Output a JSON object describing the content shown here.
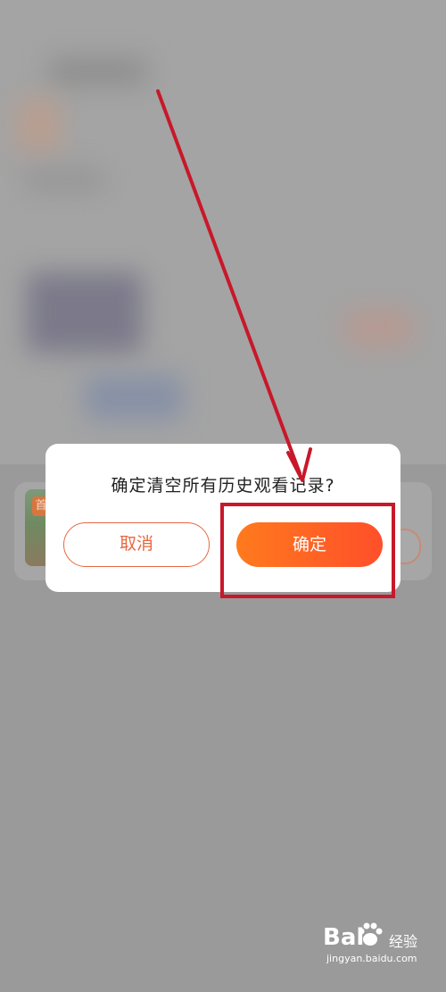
{
  "dialog": {
    "title": "确定清空所有历史观看记录?",
    "cancel_label": "取消",
    "confirm_label": "确定"
  },
  "background": {
    "tag_text": "首"
  },
  "watermark": {
    "brand_prefix": "Bai",
    "brand_suffix": "经验",
    "url": "jingyan.baidu.com"
  },
  "colors": {
    "accent": "#ff5a26",
    "annotation": "#c8182a",
    "overlay": "#9a9a9a"
  }
}
